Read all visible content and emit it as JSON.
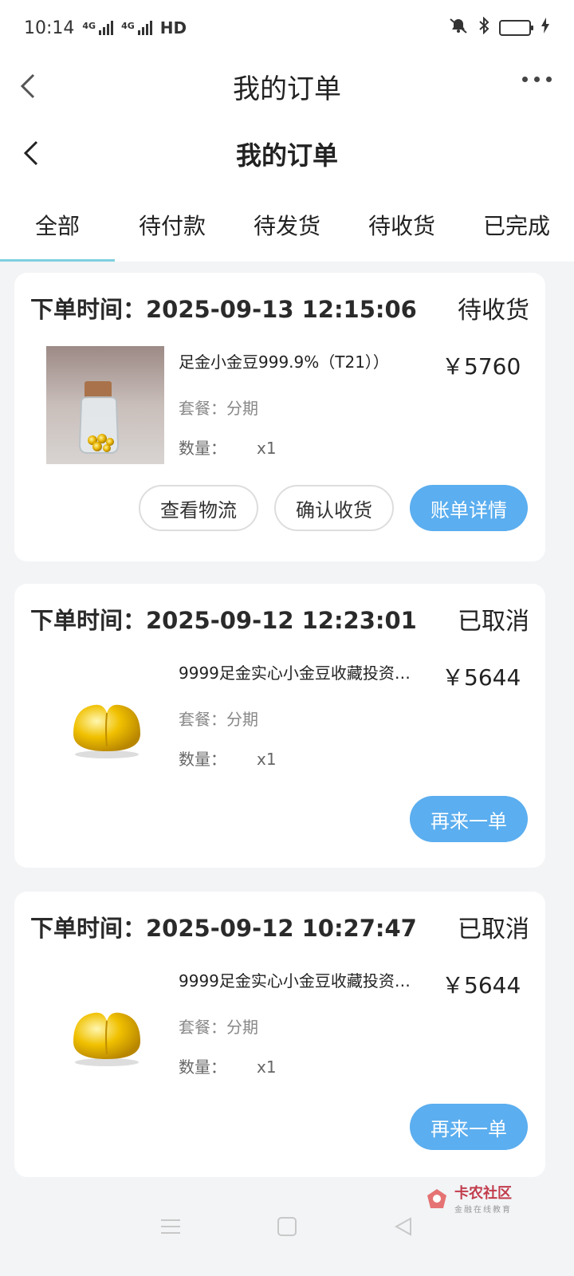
{
  "status_bar": {
    "time": "10:14",
    "network": "HD",
    "sig_label": "4G"
  },
  "header_primary": {
    "title": "我的订单"
  },
  "header_secondary": {
    "title": "我的订单"
  },
  "tabs": [
    {
      "label": "全部",
      "active": true
    },
    {
      "label": "待付款"
    },
    {
      "label": "待发货"
    },
    {
      "label": "待收货"
    },
    {
      "label": "已完成"
    }
  ],
  "orders": [
    {
      "time": "下单时间：2025-09-13 12:15:06",
      "status": "待收货",
      "product_name": "足金小金豆999.9%（T21））",
      "price": "￥5760",
      "plan": "套餐：分期",
      "qty_label": "数量：",
      "qty_value": "x1",
      "buttons": [
        "查看物流",
        "确认收货",
        "账单详情"
      ]
    },
    {
      "time": "下单时间：2025-09-12 12:23:01",
      "status": "已取消",
      "product_name": "9999足金实心小金豆收藏投资…",
      "price": "￥5644",
      "plan": "套餐：分期",
      "qty_label": "数量：",
      "qty_value": "x1",
      "buttons": [
        "再来一单"
      ]
    },
    {
      "time": "下单时间：2025-09-12 10:27:47",
      "status": "已取消",
      "product_name": "9999足金实心小金豆收藏投资…",
      "price": "￥5644",
      "plan": "套餐：分期",
      "qty_label": "数量：",
      "qty_value": "x1",
      "buttons": [
        "再来一单"
      ]
    }
  ],
  "watermark": {
    "main": "卡农社区",
    "sub": "金融在线教育"
  },
  "colors": {
    "accent_blue": "#5baeef",
    "tab_underline": "#7fd0e0",
    "gold": "#e0a800"
  }
}
